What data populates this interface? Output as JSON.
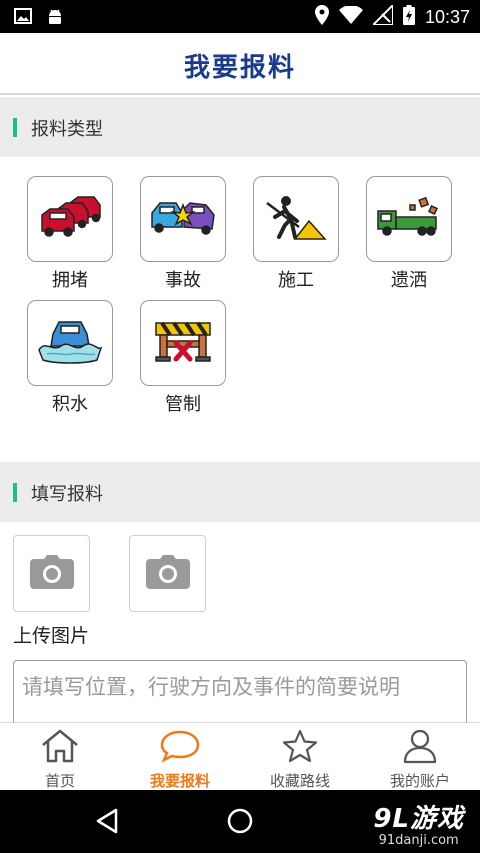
{
  "status_bar": {
    "time": "10:37"
  },
  "app_bar": {
    "title": "我要报料"
  },
  "section_types": {
    "label": "报料类型"
  },
  "types": [
    {
      "label": "拥堵",
      "icon": "traffic-jam-icon"
    },
    {
      "label": "事故",
      "icon": "car-accident-icon"
    },
    {
      "label": "施工",
      "icon": "road-work-icon"
    },
    {
      "label": "遗洒",
      "icon": "spilled-cargo-truck-icon"
    },
    {
      "label": "积水",
      "icon": "waterlogging-car-icon"
    },
    {
      "label": "管制",
      "icon": "road-barrier-icon"
    }
  ],
  "section_fill": {
    "label": "填写报料"
  },
  "upload": {
    "label": "上传图片"
  },
  "description": {
    "placeholder": "请填写位置，行驶方向及事件的简要说明"
  },
  "bottom_nav": {
    "items": [
      {
        "label": "首页",
        "icon": "home-icon"
      },
      {
        "label": "我要报料",
        "icon": "speech-bubble-icon",
        "active": true
      },
      {
        "label": "收藏路线",
        "icon": "star-icon"
      },
      {
        "label": "我的账户",
        "icon": "user-icon"
      }
    ],
    "active_color": "#f07a1a"
  },
  "watermark": {
    "main": "9L游戏",
    "sub": "91danji.com"
  }
}
